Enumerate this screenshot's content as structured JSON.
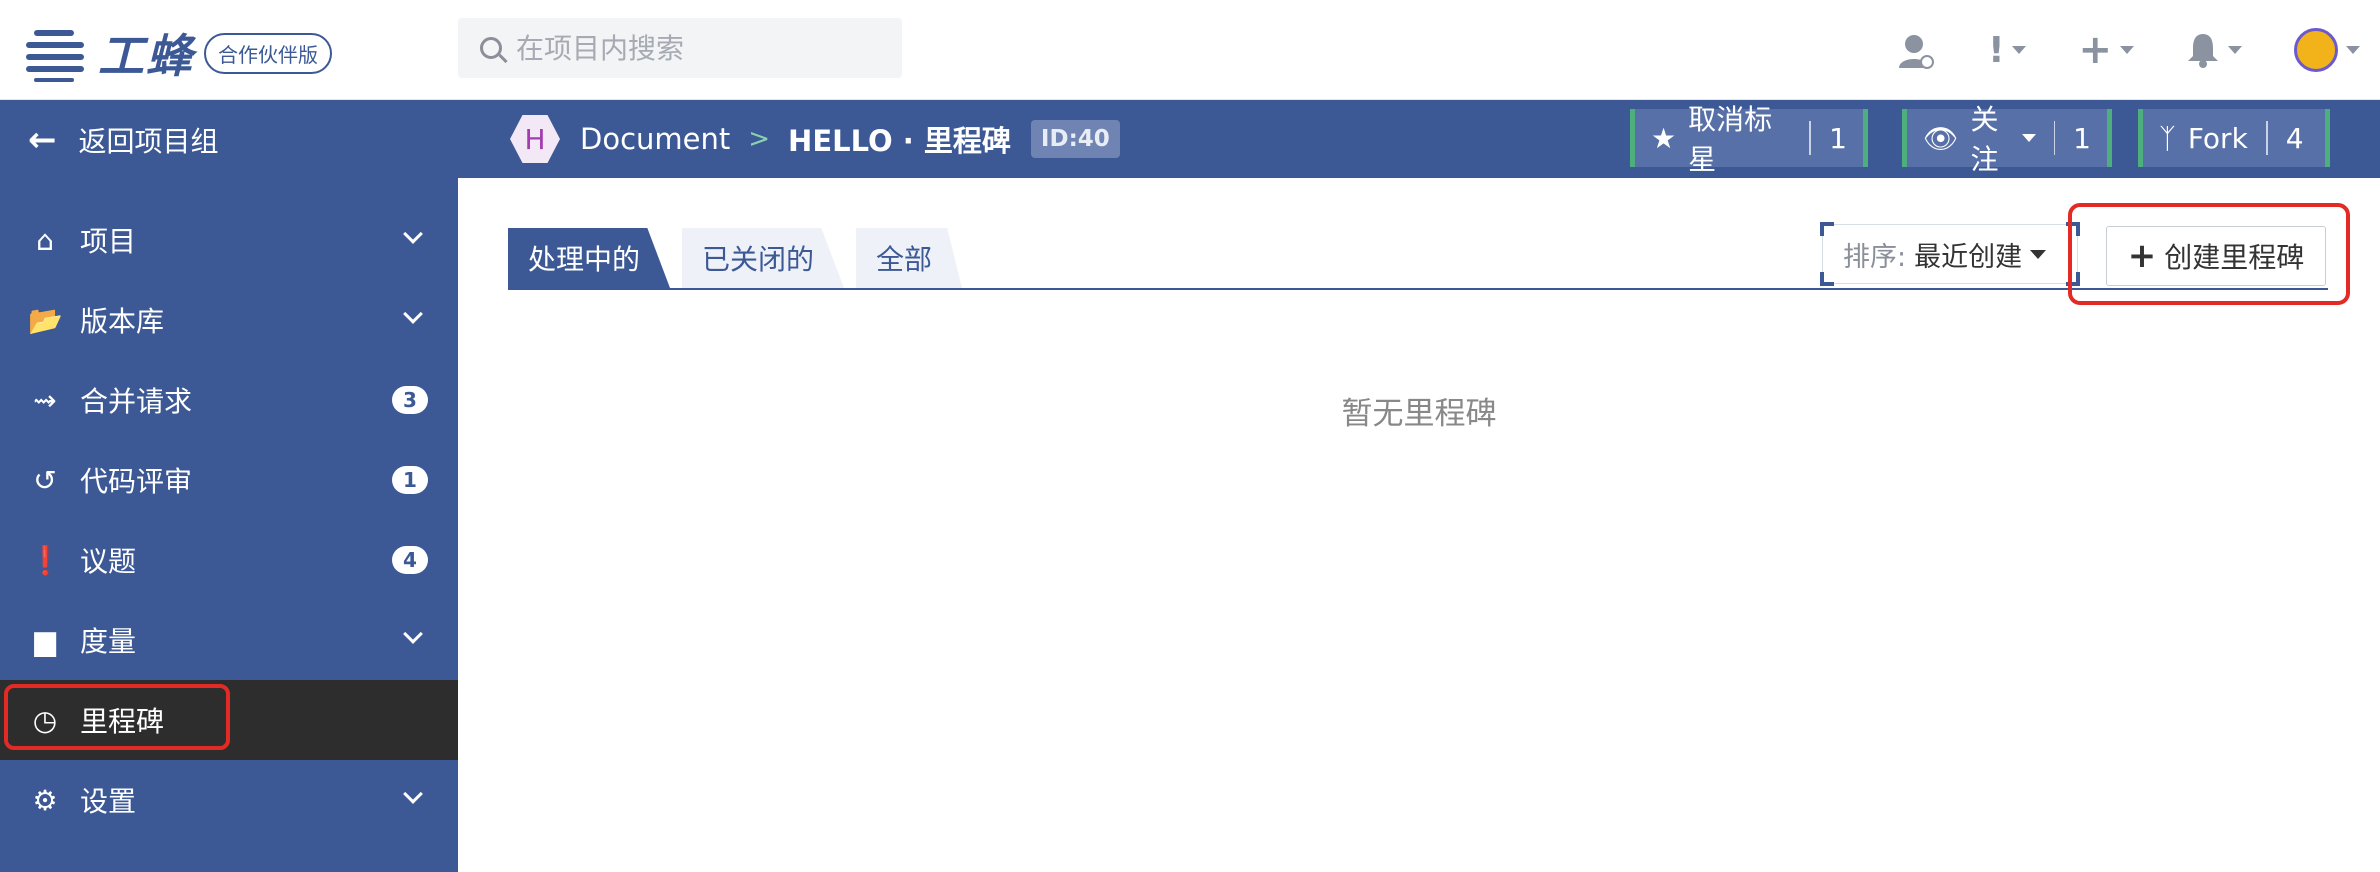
{
  "topbar": {
    "logo_text": "工蜂",
    "logo_badge": "合作伙伴版",
    "search_placeholder": "在项目内搜索",
    "icons": [
      "user-support-icon",
      "alert-icon",
      "plus-icon",
      "bell-icon",
      "avatar"
    ]
  },
  "sidebar": {
    "back_label": "返回项目组",
    "items": [
      {
        "label": "项目",
        "icon": "home-icon",
        "expandable": true
      },
      {
        "label": "版本库",
        "icon": "folder-icon",
        "expandable": true
      },
      {
        "label": "合并请求",
        "icon": "merge-icon",
        "badge": "3"
      },
      {
        "label": "代码评审",
        "icon": "review-icon",
        "badge": "1"
      },
      {
        "label": "议题",
        "icon": "issue-icon",
        "badge": "4"
      },
      {
        "label": "度量",
        "icon": "chart-icon",
        "expandable": true
      },
      {
        "label": "里程碑",
        "icon": "clock-icon",
        "active": true
      },
      {
        "label": "设置",
        "icon": "gear-icon",
        "expandable": true
      }
    ]
  },
  "header": {
    "project_initial": "H",
    "project_group": "Document",
    "separator": ">",
    "current": "HELLO · 里程碑",
    "id_badge": "ID:40",
    "unstar_label": "取消标星",
    "unstar_count": "1",
    "watch_label": "关注",
    "watch_count": "1",
    "fork_label": "Fork",
    "fork_count": "4"
  },
  "main": {
    "tabs": [
      "处理中的",
      "已关闭的",
      "全部"
    ],
    "sort_label": "排序:",
    "sort_value": "最近创建",
    "create_button": "创建里程碑",
    "empty_text": "暂无里程碑"
  },
  "colors": {
    "brand": "#3c5996",
    "active_nav": "#2d2d2e",
    "highlight": "#e42a24",
    "action_border": "#4caf7d"
  }
}
